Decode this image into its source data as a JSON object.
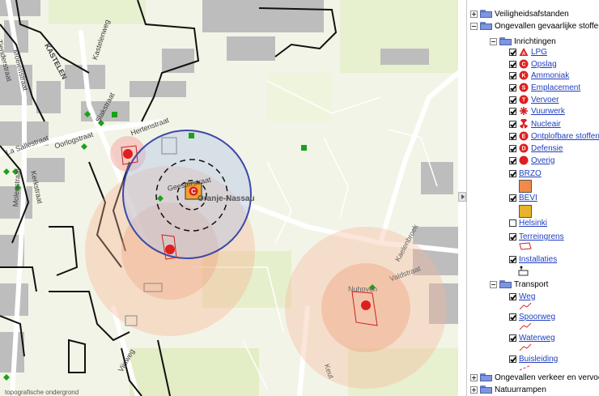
{
  "map": {
    "street_labels": [
      "Veiligheidsafstanden",
      "KASTELEN",
      "Kastelenweg",
      "Oorlogstraat",
      "Slakstraat",
      "Hertenstraat",
      "Kerkstraat",
      "Molenstraat",
      "Tienderstraat",
      "Moeienstraat",
      "La Sallestraat",
      "Geesterstraat",
      "Oranje-Nassau",
      "Nuhoven",
      "Valdstraat",
      "Kaelenbroek",
      "Vijsweg",
      "Keut"
    ],
    "copyright": "topografische ondergrond"
  },
  "panel": {
    "items": {
      "veiligheidsafstanden": "Veiligheidsafstanden",
      "ongevallen_gevaarlijke_stoffen": "Ongevallen gevaarlijke stoffen",
      "inrichtingen": "Inrichtingen",
      "lpg": "LPG",
      "opslag": "Opslag",
      "ammoniak": "Ammoniak",
      "emplacement": "Emplacement",
      "vervoer": "Vervoer",
      "vuurwerk": "Vuurwerk",
      "nucleair": "Nucleair",
      "ontplofbare_stoffen": "Ontplofbare stoffen",
      "defensie": "Defensie",
      "overig": "Overig",
      "brzo": "BRZO",
      "bevi": "BEVI",
      "helsinki": "Helsinki",
      "terreingrens": "Terreingrens",
      "installaties": "Installaties",
      "transport": "Transport",
      "weg": "Weg",
      "spoorweg": "Spoorweg",
      "waterweg": "Waterweg",
      "buisleiding": "Buisleiding",
      "ongevallen_verkeer": "Ongevallen verkeer en vervoer",
      "natuurrampen": "Natuurrampen"
    },
    "icon_letters": {
      "lpg": "A",
      "opslag": "C",
      "ammoniak": "K",
      "emplacement": "S",
      "vervoer": "T",
      "ontplofbare_stoffen": "E",
      "defensie": "D"
    },
    "colors": {
      "icon_red": "#dd1f1f",
      "brzo_fill": "#f08b4a",
      "bevi_fill": "#e8b32a",
      "link": "#1f3fbf",
      "folder": "#7d96dd"
    }
  }
}
